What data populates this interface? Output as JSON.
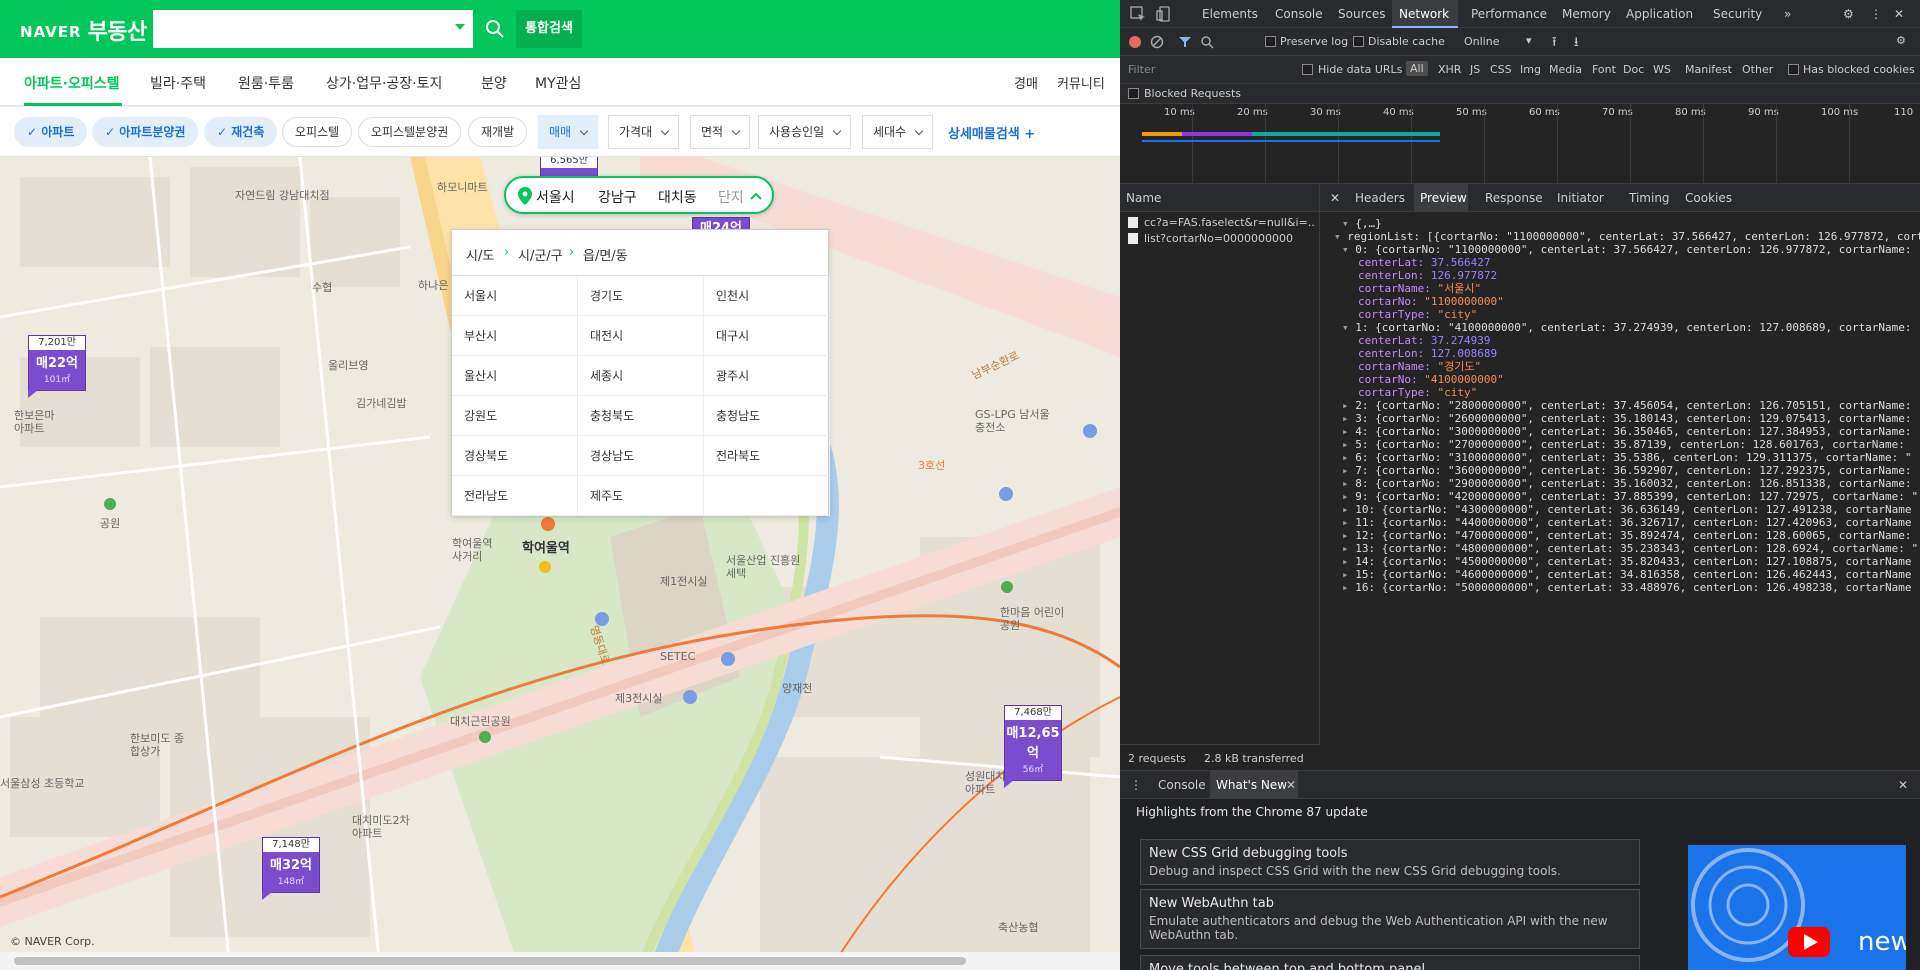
{
  "site": {
    "logo_naver": "NAVER",
    "logo_service": "부동산",
    "search_placeholder": "",
    "integrated_search": "통합검색"
  },
  "categories": [
    {
      "label": "아파트·오피스텔",
      "active": true
    },
    {
      "label": "빌라·주택"
    },
    {
      "label": "원룸·투룸"
    },
    {
      "label": "상가·업무·공장·토지"
    },
    {
      "label": "분양"
    },
    {
      "label": "MY관심"
    }
  ],
  "right_links": [
    "경매",
    "커뮤니티"
  ],
  "filters": {
    "chips": [
      {
        "label": "아파트",
        "on": true
      },
      {
        "label": "아파트분양권",
        "on": true
      },
      {
        "label": "재건축",
        "on": true
      },
      {
        "label": "오피스텔",
        "on": false
      },
      {
        "label": "오피스텔분양권",
        "on": false
      },
      {
        "label": "재개발",
        "on": false
      }
    ],
    "dropdowns": [
      {
        "label": "매매",
        "on": true
      },
      {
        "label": "가격대"
      },
      {
        "label": "면적"
      },
      {
        "label": "사용승인일"
      },
      {
        "label": "세대수"
      }
    ],
    "advanced": "상세매물검색 +"
  },
  "breadcrumb": {
    "city": "서울시",
    "district": "강남구",
    "dong": "대치동",
    "complex": "단지"
  },
  "region_panel": {
    "tabs": [
      "시/도",
      "시/군/구",
      "읍/면/동"
    ],
    "regions": [
      "서울시",
      "경기도",
      "인천시",
      "부산시",
      "대전시",
      "대구시",
      "울산시",
      "세종시",
      "광주시",
      "강원도",
      "충청북도",
      "충청남도",
      "경상북도",
      "경상남도",
      "전라북도",
      "전라남도",
      "제주도",
      ""
    ]
  },
  "map": {
    "labels": {
      "road1": "영동대로",
      "road2": "남부순환로",
      "line3": "3호선",
      "station": "학여울역",
      "station_exit": "학여울역 사거리",
      "setec": "SETEC",
      "first_hall": "제1전시실",
      "third_hall": "제3전시실",
      "seoul_center": "서울산업 진흥원세택",
      "daechi_park": "대치근린공원",
      "yangjae": "양재천",
      "lpg": "GS-LPG 남서울충전소",
      "hanmaeum": "한마음 어린이공원",
      "hanaro": "하나은",
      "olympic": "올리브영",
      "kim": "김가네김밥",
      "jayeon": "자연드림 강남대치점",
      "hamo": "하모니마트",
      "suhyeop": "수협",
      "park": "공원",
      "hanbo_apt": "한보은마 아파트",
      "hanbo_mido": "한보미도 종합상가",
      "samsung": "서울삼성 초등학교",
      "daechi2": "대치미도2차 아파트",
      "seongwon": "성원대치 2단지아파트",
      "chuksan": "축산농협"
    },
    "markers": [
      {
        "top": "7,201만",
        "price": "매22억",
        "area": "101㎡"
      },
      {
        "top": "7,468만",
        "price": "매12,65억",
        "area": "56㎡"
      },
      {
        "top": "7,148만",
        "price": "매32억",
        "area": "148㎡"
      },
      {
        "top": "6,565만",
        "price": "",
        "area": ""
      },
      {
        "top": "",
        "price": "매24억",
        "area": ""
      }
    ],
    "copyright": "© NAVER Corp."
  },
  "devtools": {
    "tabs": [
      "Elements",
      "Console",
      "Sources",
      "Network",
      "Performance",
      "Memory",
      "Application",
      "Security"
    ],
    "active_tab": "Network",
    "toolbar": {
      "preserve_log": "Preserve log",
      "disable_cache": "Disable cache",
      "throttle": "Online"
    },
    "filter": {
      "placeholder": "Filter",
      "hide_data_urls": "Hide data URLs",
      "types": [
        "All",
        "XHR",
        "JS",
        "CSS",
        "Img",
        "Media",
        "Font",
        "Doc",
        "WS",
        "Manifest",
        "Other"
      ],
      "has_blocked": "Has blocked cookies",
      "blocked_requests": "Blocked Requests"
    },
    "timeline_ticks": [
      "10 ms",
      "20 ms",
      "30 ms",
      "40 ms",
      "50 ms",
      "60 ms",
      "70 ms",
      "80 ms",
      "90 ms",
      "100 ms",
      "110"
    ],
    "name_header": "Name",
    "requests": [
      "cc?a=FAS.faselect&r=null&i=...",
      "list?cortarNo=0000000000"
    ],
    "detail_tabs": [
      "Headers",
      "Preview",
      "Response",
      "Initiator",
      "Timing",
      "Cookies"
    ],
    "detail_active": "Preview",
    "status": {
      "requests": "2 requests",
      "transferred": "2.8 kB transferred"
    },
    "json_lines": [
      "{,…}",
      "regionList: [{cortarNo: \"1100000000\", centerLat: 37.566427, centerLon: 126.977872, cort",
      "0: {cortarNo: \"1100000000\", centerLat: 37.566427, centerLon: 126.977872, cortarName:",
      "centerLat: 37.566427",
      "centerLon: 126.977872",
      "cortarName: \"서울시\"",
      "cortarNo: \"1100000000\"",
      "cortarType: \"city\"",
      "1: {cortarNo: \"4100000000\", centerLat: 37.274939, centerLon: 127.008689, cortarName:",
      "centerLat: 37.274939",
      "centerLon: 127.008689",
      "cortarName: \"경기도\"",
      "cortarNo: \"4100000000\"",
      "cortarType: \"city\"",
      "2: {cortarNo: \"2800000000\", centerLat: 37.456054, centerLon: 126.705151, cortarName:",
      "3: {cortarNo: \"2600000000\", centerLat: 35.180143, centerLon: 129.075413, cortarName:",
      "4: {cortarNo: \"3000000000\", centerLat: 36.350465, centerLon: 127.384953, cortarName:",
      "5: {cortarNo: \"2700000000\", centerLat: 35.87139, centerLon: 128.601763, cortarName:",
      "6: {cortarNo: \"3100000000\", centerLat: 35.5386, centerLon: 129.311375, cortarName: \"",
      "7: {cortarNo: \"3600000000\", centerLat: 36.592907, centerLon: 127.292375, cortarName:",
      "8: {cortarNo: \"2900000000\", centerLat: 35.160032, centerLon: 126.851338, cortarName:",
      "9: {cortarNo: \"4200000000\", centerLat: 37.885399, centerLon: 127.72975, cortarName: \"",
      "10: {cortarNo: \"4300000000\", centerLat: 36.636149, centerLon: 127.491238, cortarName",
      "11: {cortarNo: \"4400000000\", centerLat: 36.326717, centerLon: 127.420963, cortarName",
      "12: {cortarNo: \"4700000000\", centerLat: 35.892474, centerLon: 128.60065, cortarName:",
      "13: {cortarNo: \"4800000000\", centerLat: 35.238343, centerLon: 128.6924, cortarName: \"",
      "14: {cortarNo: \"4500000000\", centerLat: 35.820433, centerLon: 127.108875, cortarName",
      "15: {cortarNo: \"4600000000\", centerLat: 34.816358, centerLon: 126.462443, cortarName",
      "16: {cortarNo: \"5000000000\", centerLat: 33.488976, centerLon: 126.498238, cortarName"
    ],
    "drawer": {
      "tabs": [
        "Console",
        "What's New"
      ],
      "active": "What's New",
      "headline": "Highlights from the Chrome 87 update",
      "cards": [
        {
          "title": "New CSS Grid debugging tools",
          "desc": "Debug and inspect CSS Grid with the new CSS Grid debugging tools."
        },
        {
          "title": "New WebAuthn tab",
          "desc": "Emulate authenticators and debug the Web Authentication API with the new WebAuthn tab."
        },
        {
          "title": "Move tools between top and bottom panel",
          "desc": ""
        }
      ],
      "video_text": "new"
    }
  },
  "colors": {
    "naver_green": "#03c75a",
    "marker_purple": "#7b4ccd",
    "devtools_bg": "#242424",
    "accent_blue": "#1c6fd6"
  }
}
